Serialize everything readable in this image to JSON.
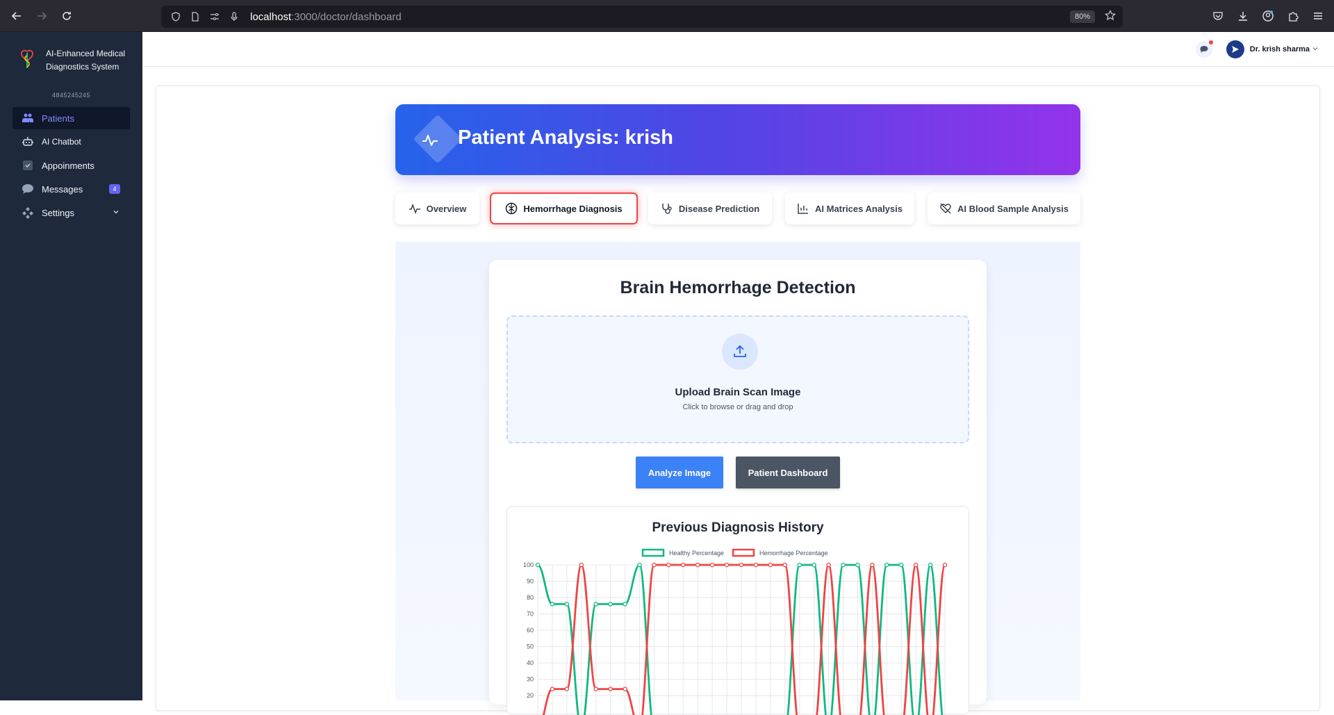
{
  "browser": {
    "url_host": "localhost",
    "url_rest": ":3000/doctor/dashboard",
    "zoom": "80%"
  },
  "sidebar": {
    "brand_line1": "AI-Enhanced Medical",
    "brand_line2": "Diagnostics System",
    "doctor_id": "4845245245",
    "items": [
      {
        "label": "Patients"
      },
      {
        "label": "AI Chatbot"
      },
      {
        "label": "Appoinments"
      },
      {
        "label": "Messages",
        "badge": "4"
      },
      {
        "label": "Settings"
      }
    ]
  },
  "header": {
    "user_name": "Dr. krish sharma"
  },
  "hero": {
    "title": "Patient Analysis: krish"
  },
  "tabs": [
    {
      "label": "Overview"
    },
    {
      "label": "Hemorrhage Diagnosis"
    },
    {
      "label": "Disease Prediction"
    },
    {
      "label": "AI Matrices Analysis"
    },
    {
      "label": "AI Blood Sample Analysis"
    }
  ],
  "detection": {
    "title": "Brain Hemorrhage Detection",
    "upload_title": "Upload Brain Scan Image",
    "upload_sub": "Click to browse or drag and drop",
    "analyze_label": "Analyze Image",
    "dashboard_label": "Patient Dashboard",
    "history_title": "Previous Diagnosis History"
  },
  "colors": {
    "healthy": "#10b981",
    "hemorrhage": "#ef4444",
    "accent": "#6366f1"
  },
  "chart_data": {
    "type": "line",
    "title": "Previous Diagnosis History",
    "xlabel": "",
    "ylabel": "",
    "ylim": [
      0,
      100
    ],
    "y_ticks": [
      100,
      90,
      80,
      70,
      60,
      50,
      40,
      30,
      20
    ],
    "legend_position": "top",
    "grid": true,
    "series": [
      {
        "name": "Healthy Percentage",
        "color": "#10b981",
        "values": [
          100,
          76,
          76,
          0,
          76,
          76,
          76,
          100,
          0,
          0,
          0,
          0,
          0,
          0,
          0,
          0,
          0,
          0,
          100,
          100,
          0,
          100,
          100,
          0,
          100,
          100,
          0,
          100,
          0
        ]
      },
      {
        "name": "Hemorrhage Percentage",
        "color": "#ef4444",
        "values": [
          0,
          24,
          24,
          100,
          24,
          24,
          24,
          0,
          100,
          100,
          100,
          100,
          100,
          100,
          100,
          100,
          100,
          100,
          0,
          0,
          100,
          0,
          0,
          100,
          0,
          0,
          100,
          0,
          100
        ]
      }
    ]
  }
}
